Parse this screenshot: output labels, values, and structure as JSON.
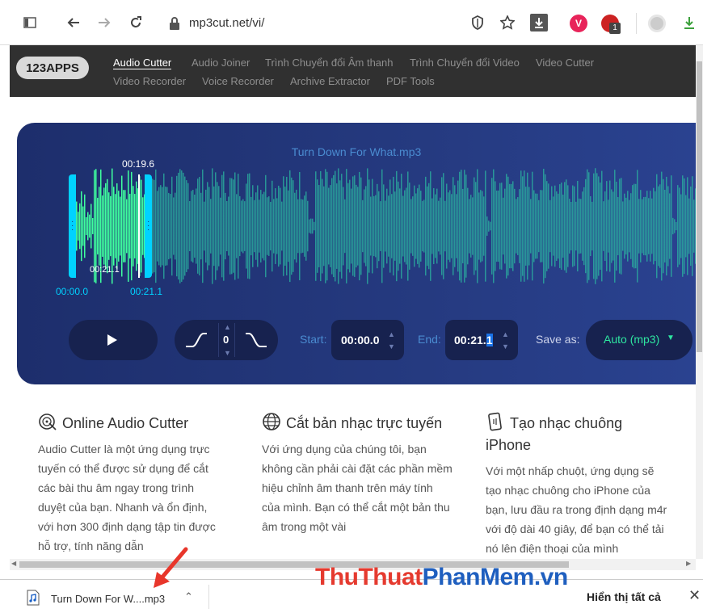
{
  "browser": {
    "url": "mp3cut.net/vi/",
    "badge_count": "1"
  },
  "site": {
    "logo": "123APPS",
    "nav": [
      {
        "label": "Audio Cutter",
        "active": true
      },
      {
        "label": "Audio Joiner"
      },
      {
        "label": "Trình Chuyển đổi Âm thanh"
      },
      {
        "label": "Trình Chuyển đổi Video"
      },
      {
        "label": "Video Cutter"
      },
      {
        "label": "Video Recorder"
      },
      {
        "label": "Voice Recorder"
      },
      {
        "label": "Archive Extractor"
      },
      {
        "label": "PDF Tools"
      }
    ]
  },
  "editor": {
    "filename": "Turn Down For What.mp3",
    "cursor_time": "00:19.6",
    "selection_length": "00:21.1",
    "start_marker": "00:00.0",
    "end_marker": "00:21.1",
    "fade_value": "0",
    "start_label": "Start:",
    "start_value": "00:00.0",
    "end_label": "End:",
    "end_value_main": "00:21.",
    "end_value_selected": "1",
    "save_as_label": "Save as:",
    "format": "Auto (mp3)",
    "colors": {
      "accent": "#00d2ff",
      "wave_selected": "#3fff9e",
      "wave": "#2bb5a0",
      "format_text": "#2ee6a0"
    }
  },
  "columns": [
    {
      "icon": "vinyl-scissors-icon",
      "title": "Online Audio Cutter",
      "text": "Audio Cutter là một ứng dụng trực tuyến có thể được sử dụng để cắt các bài thu âm ngay trong trình duyệt của bạn. Nhanh và ổn định, với hơn 300 định dạng tập tin được hỗ trợ, tính năng dẫn"
    },
    {
      "icon": "globe-icon",
      "title": "Cắt bản nhạc trực tuyến",
      "text": "Với ứng dụng của chúng tôi, bạn không cần phải cài đặt các phần mềm hiệu chỉnh âm thanh trên máy tính của mình. Bạn có thể cắt một bản thu âm trong một vài"
    },
    {
      "icon": "phone-ringtone-icon",
      "title": "Tạo nhạc chuông iPhone",
      "text": "Với một nhấp chuột, ứng dụng sẽ tạo nhạc chuông cho iPhone của bạn, lưu đầu ra trong định dạng m4r với độ dài 40 giây, để bạn có thể tải nó lên điện thoại của mình"
    }
  ],
  "download_bar": {
    "file_name": "Turn Down For W....mp3",
    "show_all": "Hiển thị tất cả"
  },
  "watermark": {
    "part1": "Thu",
    "part2": "Thuat",
    "part3": "PhanMem",
    "part4": ".vn"
  }
}
